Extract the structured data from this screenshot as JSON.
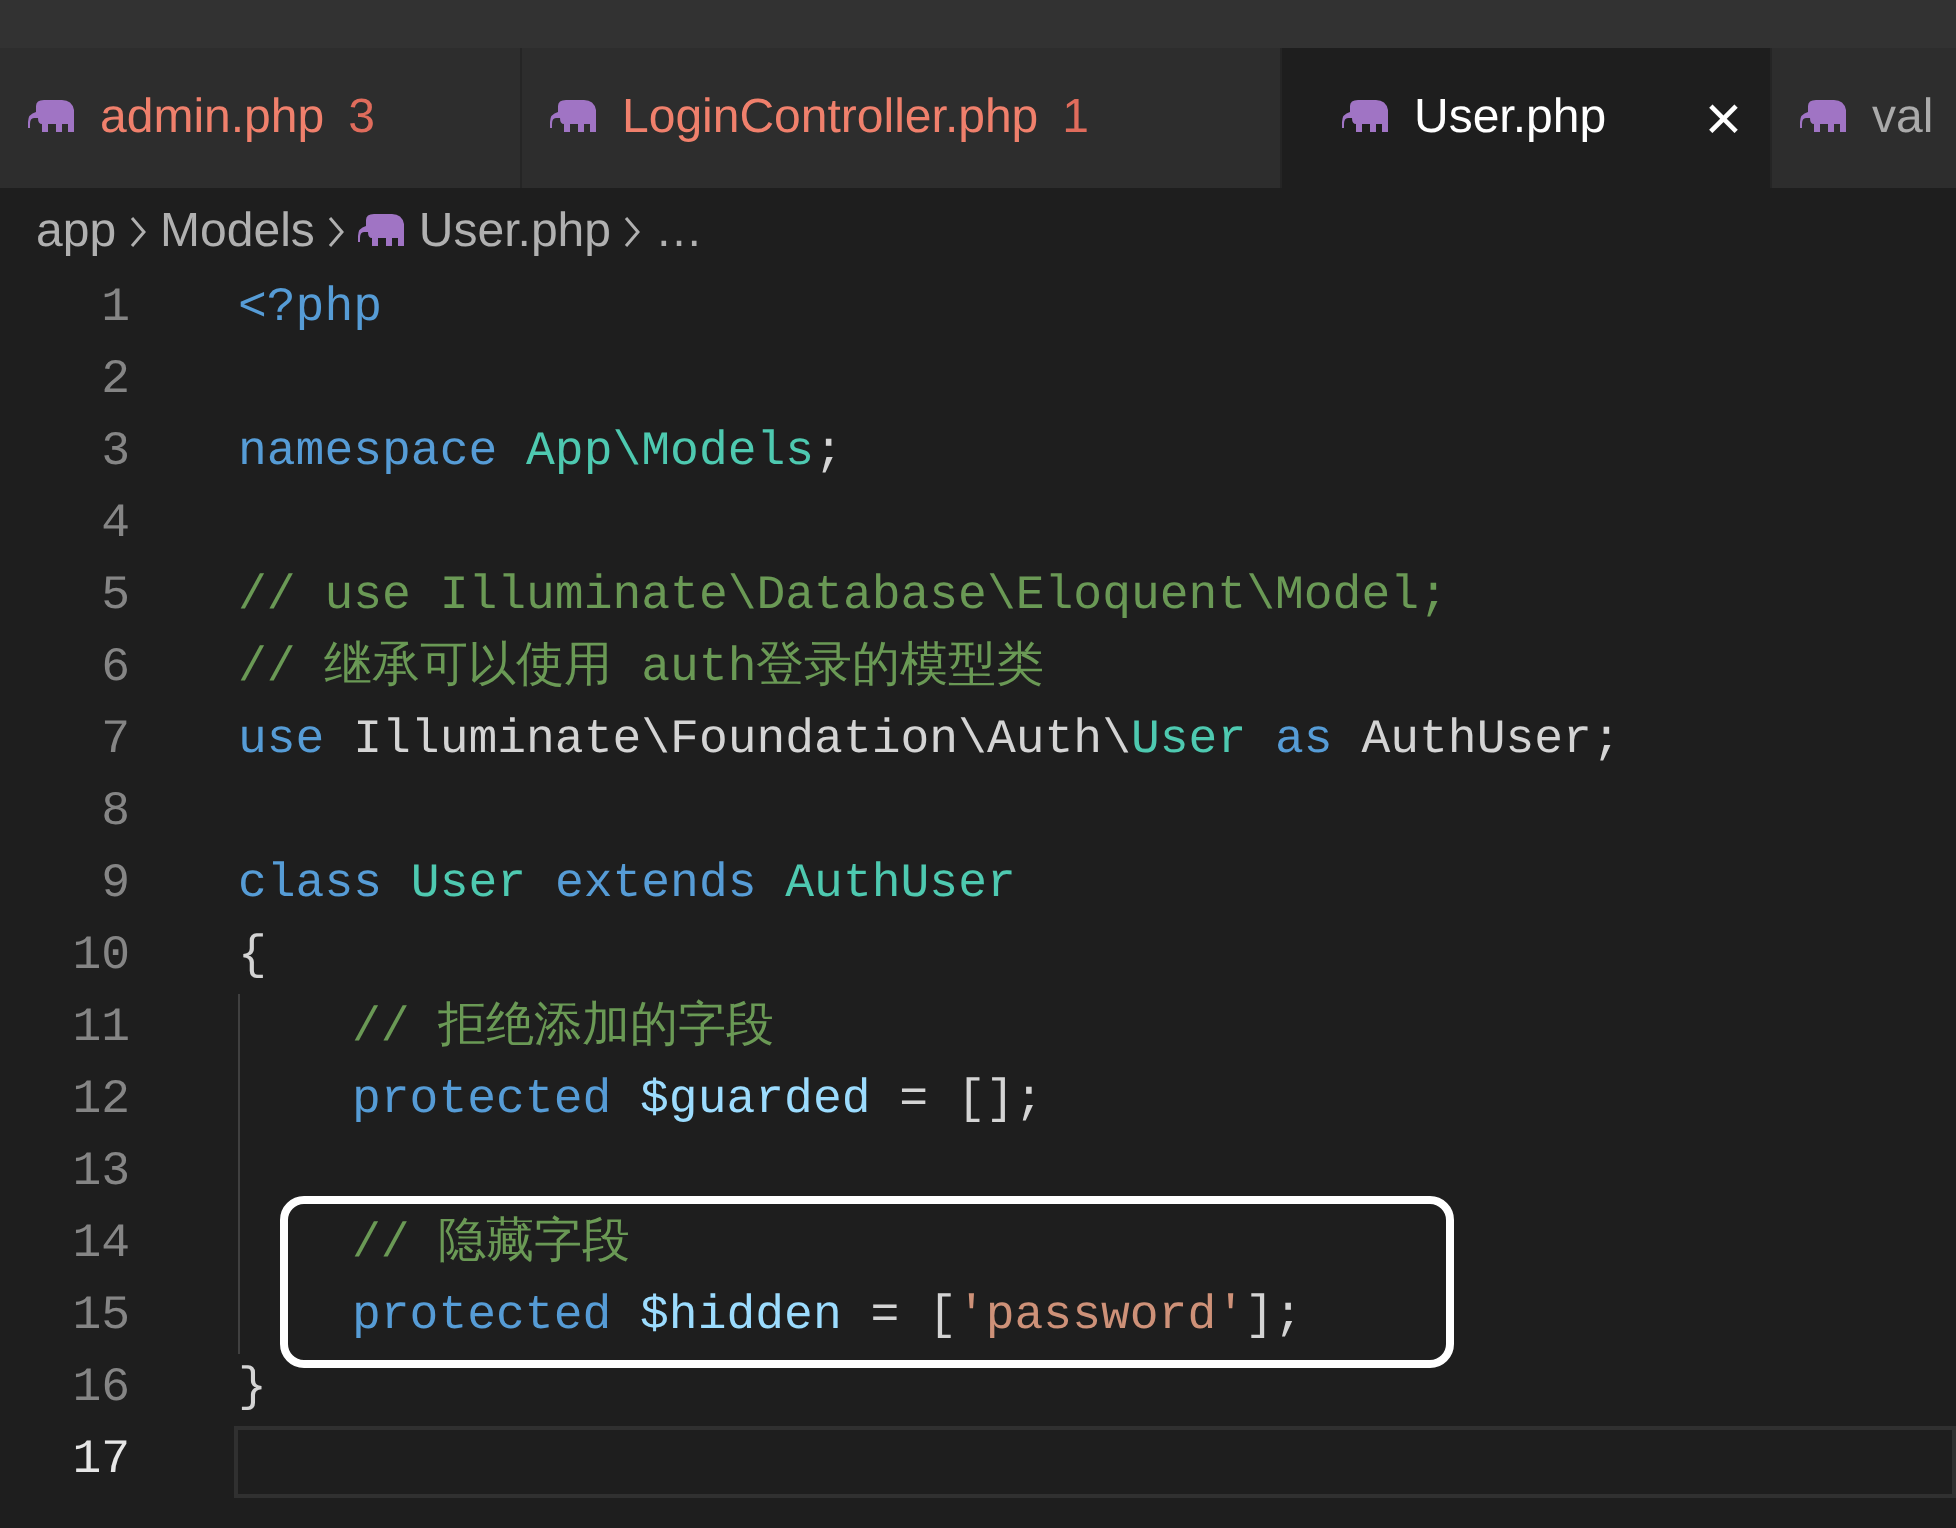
{
  "tabs": [
    {
      "label": "admin.php",
      "problems": "3",
      "selected": false,
      "error": true
    },
    {
      "label": "LoginController.php",
      "problems": "1",
      "selected": false,
      "error": true
    },
    {
      "label": "User.php",
      "close": "×",
      "selected": true,
      "error": false
    },
    {
      "label": "val",
      "selected": false,
      "error": false
    }
  ],
  "breadcrumb": [
    {
      "label": "app",
      "kind": "folder"
    },
    {
      "label": "Models",
      "kind": "folder"
    },
    {
      "label": "User.php",
      "kind": "file"
    },
    {
      "label": "…",
      "kind": "more"
    }
  ],
  "lines": [
    {
      "number": "1",
      "indented": false,
      "boxed": false,
      "current": false,
      "tokens": [
        {
          "text": "<?php",
          "kind": "keyword"
        }
      ]
    },
    {
      "number": "2",
      "indented": false,
      "boxed": false,
      "current": false
    },
    {
      "number": "3",
      "indented": false,
      "boxed": false,
      "current": false,
      "tokens": [
        {
          "text": "namespace ",
          "kind": "keyword"
        },
        {
          "text": "App\\Models",
          "kind": "type"
        },
        {
          "text": ";",
          "kind": "plain"
        }
      ]
    },
    {
      "number": "4",
      "indented": false,
      "boxed": false,
      "current": false
    },
    {
      "number": "5",
      "indented": false,
      "boxed": false,
      "current": false,
      "tokens": [
        {
          "text": "// use Illuminate\\Database\\Eloquent\\Model;",
          "kind": "comment"
        }
      ]
    },
    {
      "number": "6",
      "indented": false,
      "boxed": false,
      "current": false,
      "tokens": [
        {
          "text": "// 继承可以使用 auth登录的模型类",
          "kind": "comment"
        }
      ]
    },
    {
      "number": "7",
      "indented": false,
      "boxed": false,
      "current": false,
      "tokens": [
        {
          "text": "use ",
          "kind": "keyword"
        },
        {
          "text": "Illuminate\\Foundation\\Auth\\",
          "kind": "plain"
        },
        {
          "text": "User ",
          "kind": "type"
        },
        {
          "text": "as ",
          "kind": "keyword"
        },
        {
          "text": "AuthUser;",
          "kind": "plain"
        }
      ]
    },
    {
      "number": "8",
      "indented": false,
      "boxed": false,
      "current": false
    },
    {
      "number": "9",
      "indented": false,
      "boxed": false,
      "current": false,
      "tokens": [
        {
          "text": "class ",
          "kind": "keyword"
        },
        {
          "text": "User ",
          "kind": "type"
        },
        {
          "text": "extends ",
          "kind": "keyword"
        },
        {
          "text": "AuthUser",
          "kind": "type"
        }
      ]
    },
    {
      "number": "10",
      "indented": false,
      "boxed": false,
      "current": false,
      "tokens": [
        {
          "text": "{",
          "kind": "plain"
        }
      ]
    },
    {
      "number": "11",
      "indented": true,
      "boxed": false,
      "current": false,
      "tokens": [
        {
          "text": "// 拒绝添加的字段",
          "kind": "comment"
        }
      ]
    },
    {
      "number": "12",
      "indented": true,
      "boxed": false,
      "current": false,
      "tokens": [
        {
          "text": "protected ",
          "kind": "keyword"
        },
        {
          "text": "$guarded",
          "kind": "variable"
        },
        {
          "text": " = [];",
          "kind": "plain"
        }
      ]
    },
    {
      "number": "13",
      "indented": true,
      "boxed": false,
      "current": false
    },
    {
      "number": "14",
      "indented": true,
      "boxed": true,
      "current": false,
      "tokens": [
        {
          "text": "// 隐藏字段",
          "kind": "comment"
        }
      ]
    },
    {
      "number": "15",
      "indented": true,
      "boxed": true,
      "current": false,
      "tokens": [
        {
          "text": "protected ",
          "kind": "keyword"
        },
        {
          "text": "$hidden",
          "kind": "variable"
        },
        {
          "text": " = [",
          "kind": "plain"
        },
        {
          "text": "'password'",
          "kind": "string"
        },
        {
          "text": "];",
          "kind": "plain"
        }
      ]
    },
    {
      "number": "16",
      "indented": false,
      "boxed": false,
      "current": false,
      "tokens": [
        {
          "text": "}",
          "kind": "plain"
        }
      ]
    },
    {
      "number": "17",
      "indented": false,
      "boxed": false,
      "current": true
    }
  ]
}
